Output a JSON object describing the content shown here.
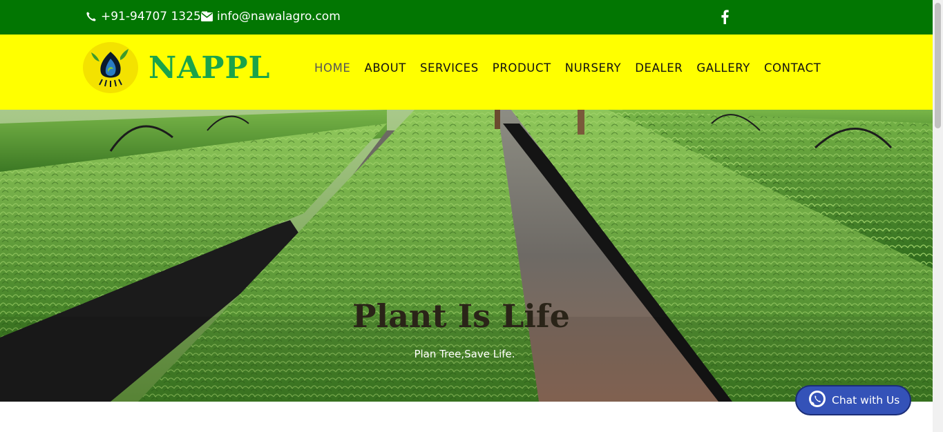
{
  "topbar": {
    "phone": "+91-94707 13257",
    "email": "info@nawalagro.com",
    "social_icon": "facebook-icon"
  },
  "header": {
    "brand": "NAPPL",
    "logo_icon": "plant-drop-logo-icon"
  },
  "nav": {
    "items": [
      "HOME",
      "ABOUT",
      "SERVICES",
      "PRODUCT",
      "NURSERY",
      "DEALER",
      "GALLERY",
      "CONTACT"
    ],
    "active": "HOME"
  },
  "hero": {
    "title": "Plant Is Life",
    "subtitle": "Plan Tree,Save Life."
  },
  "chat": {
    "label": "Chat with Us",
    "icon": "whatsapp-icon"
  },
  "colors": {
    "topbar": "#027602",
    "header": "#ffff00",
    "brand": "#1aa34a",
    "chat_button": "#3452b8"
  }
}
